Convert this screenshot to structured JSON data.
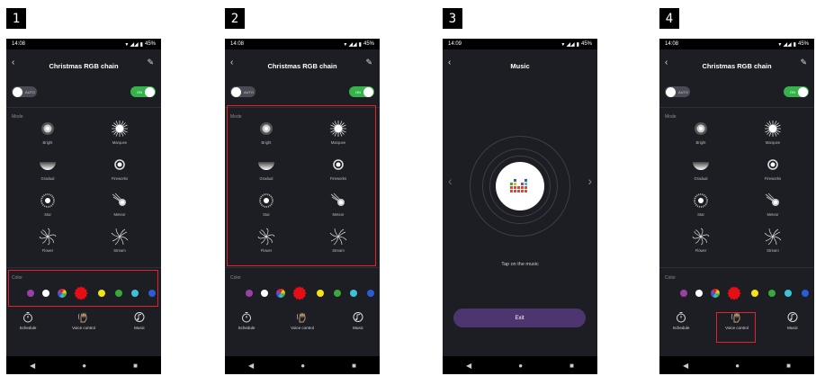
{
  "steps": [
    "1",
    "2",
    "3",
    "4"
  ],
  "status": {
    "time_a": "14:08",
    "time_b": "14:09",
    "battery": "45%"
  },
  "device_title": "Christmas RGB chain",
  "toggles": {
    "auto_label": "AUTO",
    "on_label": "ON"
  },
  "mode": {
    "section_label": "Mode",
    "items": [
      {
        "label": "Bright",
        "icon": "bright-icon"
      },
      {
        "label": "Marquee",
        "icon": "marquee-icon"
      },
      {
        "label": "Gradual",
        "icon": "gradual-icon"
      },
      {
        "label": "Fireworks",
        "icon": "fireworks-icon"
      },
      {
        "label": "Star",
        "icon": "star-icon"
      },
      {
        "label": "Meteor",
        "icon": "meteor-icon"
      },
      {
        "label": "Flower",
        "icon": "flower-icon"
      },
      {
        "label": "Stream",
        "icon": "stream-icon"
      }
    ]
  },
  "color": {
    "section_label": "Color",
    "swatches": [
      "#9b3fa6",
      "#ffffff",
      "rainbow",
      "#e50e14",
      "#f2e21b",
      "#3aa83a",
      "#3ec3d4",
      "#2a5bd8"
    ],
    "selected_index": 3
  },
  "bottom_nav": {
    "schedule": "Schedule",
    "voice": "Voice control",
    "music": "Music"
  },
  "music_screen": {
    "title": "Music",
    "hint": "Tap on the music",
    "exit": "Exit"
  },
  "colors": {
    "highlight": "#e4222b",
    "toggle_on": "#35b24a",
    "background": "#1d1e24"
  }
}
